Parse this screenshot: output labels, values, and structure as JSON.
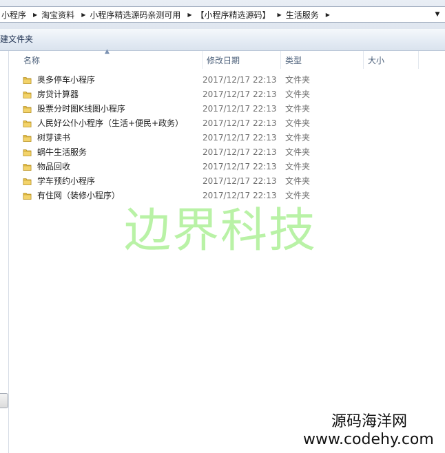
{
  "breadcrumb": [
    "小程序",
    "淘宝资料",
    "小程序精选源码亲测可用",
    "【小程序精选源码】",
    "生活服务"
  ],
  "toolbar": {
    "new_folder": "建文件夹"
  },
  "columns": {
    "name": "名称",
    "date": "修改日期",
    "type": "类型",
    "size": "大小"
  },
  "files": [
    {
      "name": "奥多停车小程序",
      "date": "2017/12/17 22:13",
      "type": "文件夹"
    },
    {
      "name": "房贷计算器",
      "date": "2017/12/17 22:13",
      "type": "文件夹"
    },
    {
      "name": "股票分时图K线图小程序",
      "date": "2017/12/17 22:13",
      "type": "文件夹"
    },
    {
      "name": "人民好公仆小程序（生活+便民+政务）",
      "date": "2017/12/17 22:13",
      "type": "文件夹"
    },
    {
      "name": "树芽读书",
      "date": "2017/12/17 22:13",
      "type": "文件夹"
    },
    {
      "name": "蜗牛生活服务",
      "date": "2017/12/17 22:13",
      "type": "文件夹"
    },
    {
      "name": "物品回收",
      "date": "2017/12/17 22:13",
      "type": "文件夹"
    },
    {
      "name": "学车预约小程序",
      "date": "2017/12/17 22:13",
      "type": "文件夹"
    },
    {
      "name": "有住网（装修小程序）",
      "date": "2017/12/17 22:13",
      "type": "文件夹"
    }
  ],
  "watermark": {
    "main": "边界科技",
    "site_name": "源码海洋网",
    "site_url": "www.codehy.com"
  },
  "icons": {
    "folder": "folder-icon",
    "separator": "chevron-right-icon",
    "dropdown": "chevron-down-icon",
    "sort": "sort-up-icon"
  },
  "colors": {
    "folder": "#e8c34a",
    "watermark": "#b9f2a6",
    "header_text": "#4c607a"
  }
}
